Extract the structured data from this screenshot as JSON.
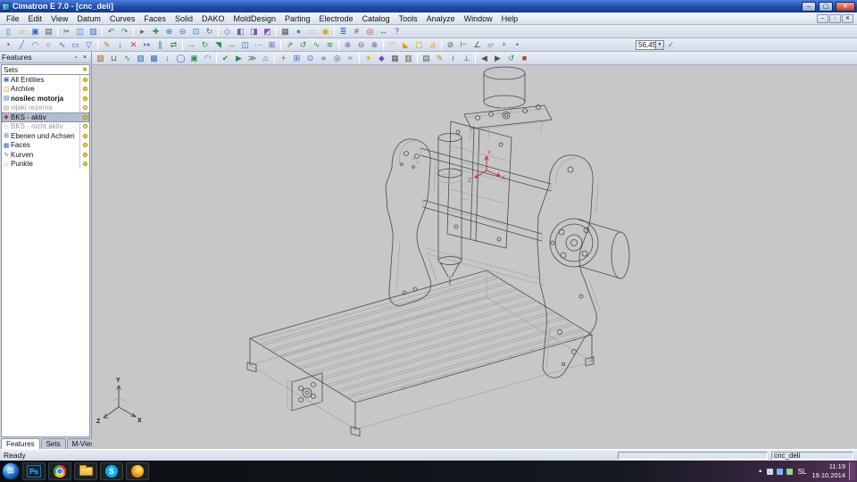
{
  "window": {
    "title": "Cimatron E 7.0 - [cnc_deli]"
  },
  "icons": {
    "minimize": "–",
    "maximize": "▢",
    "close": "✕",
    "mdi_min": "–",
    "mdi_restore": "▫",
    "mdi_close": "✕",
    "pin": "▫",
    "panel_close": "×",
    "combo_arrow": "▼",
    "start": "⊞",
    "tray_up": "▲",
    "sets_icon": "✱"
  },
  "menu": {
    "items": [
      {
        "name": "menu-file",
        "label": "File"
      },
      {
        "name": "menu-edit",
        "label": "Edit"
      },
      {
        "name": "menu-view",
        "label": "View"
      },
      {
        "name": "menu-datum",
        "label": "Datum"
      },
      {
        "name": "menu-curves",
        "label": "Curves"
      },
      {
        "name": "menu-faces",
        "label": "Faces"
      },
      {
        "name": "menu-solid",
        "label": "Solid"
      },
      {
        "name": "menu-dako",
        "label": "DAKO"
      },
      {
        "name": "menu-molddesign",
        "label": "MoldDesign"
      },
      {
        "name": "menu-parting",
        "label": "Parting"
      },
      {
        "name": "menu-electrode",
        "label": "Electrode"
      },
      {
        "name": "menu-catalog",
        "label": "Catalog"
      },
      {
        "name": "menu-tools",
        "label": "Tools"
      },
      {
        "name": "menu-analyze",
        "label": "Analyze"
      },
      {
        "name": "menu-window",
        "label": "Window"
      },
      {
        "name": "menu-help",
        "label": "Help"
      }
    ]
  },
  "toolbars": {
    "combo_value": "56,45",
    "row1": [
      {
        "name": "new-file-icon",
        "g": "▯",
        "c": "#3565c5"
      },
      {
        "name": "open-file-icon",
        "g": "▱",
        "c": "#d8a400"
      },
      {
        "name": "save-icon",
        "g": "▣",
        "c": "#3565c5"
      },
      {
        "name": "print-icon",
        "g": "▤",
        "c": "#555555"
      },
      {
        "name": "separator",
        "cls": "sep"
      },
      {
        "name": "cut-icon",
        "g": "✂",
        "c": "#555555"
      },
      {
        "name": "copy-icon",
        "g": "◫",
        "c": "#3565c5"
      },
      {
        "name": "paste-icon",
        "g": "▥",
        "c": "#3565c5"
      },
      {
        "name": "separator",
        "cls": "sep"
      },
      {
        "name": "undo-icon",
        "g": "↶",
        "c": "#2e8e4f"
      },
      {
        "name": "redo-icon",
        "g": "↷",
        "c": "#2e8e4f"
      },
      {
        "name": "separator",
        "cls": "sep"
      },
      {
        "name": "select-icon",
        "g": "▸",
        "c": "#555555"
      },
      {
        "name": "pan-icon",
        "g": "✚",
        "c": "#2e8e4f"
      },
      {
        "name": "zoom-in-icon",
        "g": "⊕",
        "c": "#3565c5"
      },
      {
        "name": "zoom-out-icon",
        "g": "⊖",
        "c": "#3565c5"
      },
      {
        "name": "zoom-fit-icon",
        "g": "⊡",
        "c": "#3565c5"
      },
      {
        "name": "rotate-view-icon",
        "g": "↻",
        "c": "#2e8e4f"
      },
      {
        "name": "separator",
        "cls": "sep"
      },
      {
        "name": "view-iso-icon",
        "g": "◇",
        "c": "#7b4fb0"
      },
      {
        "name": "view-top-icon",
        "g": "◧",
        "c": "#7b4fb0"
      },
      {
        "name": "view-front-icon",
        "g": "◨",
        "c": "#7b4fb0"
      },
      {
        "name": "view-right-icon",
        "g": "◩",
        "c": "#7b4fb0"
      },
      {
        "name": "separator",
        "cls": "sep"
      },
      {
        "name": "wireframe-icon",
        "g": "▦",
        "c": "#555555"
      },
      {
        "name": "shaded-icon",
        "g": "●",
        "c": "#2a9d8f"
      },
      {
        "name": "hide-icon",
        "g": "◌",
        "c": "#555555"
      },
      {
        "name": "show-all-icon",
        "g": "◉",
        "c": "#d8a400"
      },
      {
        "name": "separator",
        "cls": "sep"
      },
      {
        "name": "layers-icon",
        "g": "≣",
        "c": "#3565c5"
      },
      {
        "name": "grid-icon",
        "g": "#",
        "c": "#555555"
      },
      {
        "name": "snap-icon",
        "g": "◎",
        "c": "#c0392b"
      },
      {
        "name": "measure-icon",
        "g": "↔",
        "c": "#555555"
      },
      {
        "name": "help-icon",
        "g": "?",
        "c": "#3565c5"
      }
    ],
    "row2": [
      {
        "name": "point-icon",
        "g": "•",
        "c": "#c0392b"
      },
      {
        "name": "line-icon",
        "g": "╱",
        "c": "#3565c5"
      },
      {
        "name": "arc-icon",
        "g": "◠",
        "c": "#3565c5"
      },
      {
        "name": "circle-icon",
        "g": "○",
        "c": "#3565c5"
      },
      {
        "name": "spline-icon",
        "g": "∿",
        "c": "#3565c5"
      },
      {
        "name": "rectangle-icon",
        "g": "▭",
        "c": "#3565c5"
      },
      {
        "name": "polygon-icon",
        "g": "▽",
        "c": "#3565c5"
      },
      {
        "name": "separator",
        "cls": "sep"
      },
      {
        "name": "sketch-icon",
        "g": "✎",
        "c": "#b8860b"
      },
      {
        "name": "project-icon",
        "g": "↓",
        "c": "#555555"
      },
      {
        "name": "trim-icon",
        "g": "✕",
        "c": "#c0392b"
      },
      {
        "name": "extend-icon",
        "g": "↦",
        "c": "#3565c5"
      },
      {
        "name": "offset-icon",
        "g": "∥",
        "c": "#3565c5"
      },
      {
        "name": "mirror-icon",
        "g": "⇄",
        "c": "#2e8e4f"
      },
      {
        "name": "separator",
        "cls": "sep"
      },
      {
        "name": "move-icon",
        "g": "→",
        "c": "#2e8e4f"
      },
      {
        "name": "rotate-icon",
        "g": "↻",
        "c": "#2e8e4f"
      },
      {
        "name": "scale-icon",
        "g": "◥",
        "c": "#2e8e4f"
      },
      {
        "name": "stretch-icon",
        "g": "↔",
        "c": "#2e8e4f"
      },
      {
        "name": "copy-object-icon",
        "g": "◫",
        "c": "#3565c5"
      },
      {
        "name": "pattern-icon",
        "g": "⋯",
        "c": "#3565c5"
      },
      {
        "name": "array-icon",
        "g": "⊞",
        "c": "#3565c5"
      },
      {
        "name": "separator",
        "cls": "sep"
      },
      {
        "name": "extrude-icon",
        "g": "⇗",
        "c": "#2e8e4f"
      },
      {
        "name": "revolve-icon",
        "g": "↺",
        "c": "#2e8e4f"
      },
      {
        "name": "sweep-icon",
        "g": "∿",
        "c": "#2e8e4f"
      },
      {
        "name": "loft-icon",
        "g": "≋",
        "c": "#2e8e4f"
      },
      {
        "name": "separator",
        "cls": "sep"
      },
      {
        "name": "boolean-union-icon",
        "g": "⊕",
        "c": "#7b4fb0"
      },
      {
        "name": "boolean-subtract-icon",
        "g": "⊖",
        "c": "#7b4fb0"
      },
      {
        "name": "boolean-intersect-icon",
        "g": "⊗",
        "c": "#7b4fb0"
      },
      {
        "name": "separator",
        "cls": "sep"
      },
      {
        "name": "fillet-icon",
        "g": "◠",
        "c": "#d8a400"
      },
      {
        "name": "chamfer-icon",
        "g": "◣",
        "c": "#d8a400"
      },
      {
        "name": "shell-icon",
        "g": "▢",
        "c": "#d8a400"
      },
      {
        "name": "draft-icon",
        "g": "⊿",
        "c": "#d8a400"
      },
      {
        "name": "separator",
        "cls": "sep"
      },
      {
        "name": "section-icon",
        "g": "⊘",
        "c": "#555555"
      },
      {
        "name": "dimension-icon",
        "g": "⊢",
        "c": "#555555"
      },
      {
        "name": "angle-icon",
        "g": "∠",
        "c": "#555555"
      },
      {
        "name": "datum-plane-icon",
        "g": "▱",
        "c": "#7b4fb0"
      },
      {
        "name": "datum-axis-icon",
        "g": "+",
        "c": "#7b4fb0"
      },
      {
        "name": "datum-point-icon",
        "g": "•",
        "c": "#7b4fb0"
      }
    ],
    "row2b": [
      {
        "name": "apply-icon",
        "g": "✓",
        "c": "#2e8e4f"
      }
    ],
    "row3": [
      {
        "name": "stock-icon",
        "g": "▧",
        "c": "#a0622a"
      },
      {
        "name": "tool-library-icon",
        "g": "⊔",
        "c": "#555555"
      },
      {
        "name": "toolpath-icon",
        "g": "∿",
        "c": "#2e8e4f"
      },
      {
        "name": "roughing-icon",
        "g": "▨",
        "c": "#3565c5"
      },
      {
        "name": "finishing-icon",
        "g": "▩",
        "c": "#3565c5"
      },
      {
        "name": "drilling-icon",
        "g": "↓",
        "c": "#c0392b"
      },
      {
        "name": "contour-icon",
        "g": "◯",
        "c": "#3565c5"
      },
      {
        "name": "pocket-icon",
        "g": "▣",
        "c": "#2e8e4f"
      },
      {
        "name": "surface-path-icon",
        "g": "◠",
        "c": "#3565c5"
      },
      {
        "name": "separator",
        "cls": "sep"
      },
      {
        "name": "verify-icon",
        "g": "✔",
        "c": "#2e8e4f"
      },
      {
        "name": "simulate-icon",
        "g": "▶",
        "c": "#2e8e4f"
      },
      {
        "name": "post-process-icon",
        "g": "≫",
        "c": "#555555"
      },
      {
        "name": "machine-icon",
        "g": "⌂",
        "c": "#555555"
      },
      {
        "name": "separator",
        "cls": "sep"
      },
      {
        "name": "origin-icon",
        "g": "+",
        "c": "#c0392b"
      },
      {
        "name": "work-offset-icon",
        "g": "⊞",
        "c": "#3565c5"
      },
      {
        "name": "probe-icon",
        "g": "⊙",
        "c": "#3565c5"
      },
      {
        "name": "feed-rate-icon",
        "g": "∝",
        "c": "#555555"
      },
      {
        "name": "spindle-speed-icon",
        "g": "◎",
        "c": "#555555"
      },
      {
        "name": "coolant-icon",
        "g": "≈",
        "c": "#3565c5"
      },
      {
        "name": "separator",
        "cls": "sep"
      },
      {
        "name": "light-icon",
        "g": "☀",
        "c": "#d8a400"
      },
      {
        "name": "material-icon",
        "g": "◆",
        "c": "#7b4fb0"
      },
      {
        "name": "texture-icon",
        "g": "▦",
        "c": "#555555"
      },
      {
        "name": "background-icon",
        "g": "▥",
        "c": "#555555"
      },
      {
        "name": "separator",
        "cls": "sep"
      },
      {
        "name": "report-icon",
        "g": "▤",
        "c": "#555555"
      },
      {
        "name": "notes-icon",
        "g": "✎",
        "c": "#b8860b"
      },
      {
        "name": "info-icon",
        "g": "i",
        "c": "#3565c5"
      },
      {
        "name": "view-normal-icon",
        "g": "⊥",
        "c": "#555555"
      },
      {
        "name": "separator",
        "cls": "sep"
      },
      {
        "name": "previous-icon",
        "g": "◀",
        "c": "#555555"
      },
      {
        "name": "next-icon",
        "g": "▶",
        "c": "#555555"
      },
      {
        "name": "refresh-icon",
        "g": "↺",
        "c": "#2e8e4f"
      },
      {
        "name": "stop-icon",
        "g": "■",
        "c": "#c0392b"
      }
    ]
  },
  "features_panel": {
    "title": "Features",
    "sets_label": "Sets",
    "items": [
      {
        "name": "feature-item-all-entities",
        "label": "All Entities",
        "g": "▣",
        "c": "#3565c5",
        "b": "#ffd400"
      },
      {
        "name": "feature-item-archive",
        "label": "Archive",
        "g": "◫",
        "c": "#b8860b",
        "b": "#ffd400"
      },
      {
        "name": "feature-item-nosilec-motorja",
        "label": "nosilec motorja",
        "g": "▤",
        "c": "#3565c5",
        "cls": "bold",
        "b": "#ffd400"
      },
      {
        "name": "feature-item-vijaki-rezerva",
        "label": "vijaki rezerva",
        "g": "▤",
        "c": "#9a9a9a",
        "cls": "gray",
        "b": "#ece2a8"
      },
      {
        "name": "feature-item-bks-aktiv",
        "label": "BKS - aktiv",
        "g": "◆",
        "c": "#c0392b",
        "cls": "selected",
        "b": "#ffd400"
      },
      {
        "name": "feature-item-bks-nicht-aktiv",
        "label": "BKS - nicht aktiv",
        "g": "◇",
        "c": "#9a9a9a",
        "cls": "gray",
        "b": "#ece2a8"
      },
      {
        "name": "feature-item-ebenen-und-achsen",
        "label": "Ebenen und Achsen",
        "g": "⊞",
        "c": "#3565c5",
        "b": "#ffd400"
      },
      {
        "name": "feature-item-faces",
        "label": "Faces",
        "g": "▦",
        "c": "#3565c5",
        "b": "#ffd400"
      },
      {
        "name": "feature-item-kurven",
        "label": "Kurven",
        "g": "∿",
        "c": "#3565c5",
        "b": "#ffd400"
      },
      {
        "name": "feature-item-punkte",
        "label": "Punkte",
        "g": "∴",
        "c": "#3565c5",
        "b": "#ffd400"
      }
    ],
    "tabs": [
      {
        "name": "tab-features",
        "label": "Features",
        "cls": "active"
      },
      {
        "name": "tab-sets",
        "label": "Sets"
      },
      {
        "name": "tab-m-view",
        "label": "M-View"
      }
    ]
  },
  "canvas": {
    "triad": {
      "x": "X",
      "y": "Y",
      "z": "Z"
    },
    "ucs": {
      "x": "X",
      "y": "Y",
      "z": "Z"
    }
  },
  "status": {
    "ready": "Ready",
    "doc": "cnc_deli"
  },
  "taskbar": {
    "ps": "Ps",
    "skype": "S",
    "tray": {
      "lang": "SL",
      "time": "11:19",
      "date": "19.10.2014"
    }
  }
}
